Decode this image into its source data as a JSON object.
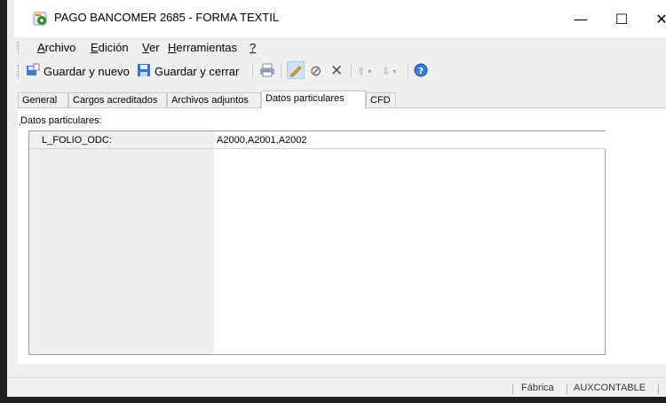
{
  "window": {
    "title": "PAGO BANCOMER 2685 - FORMA TEXTIL",
    "minimize": "—",
    "maximize": "☐",
    "close": "✕"
  },
  "menu": [
    {
      "label": "Archivo",
      "accel": "A",
      "rest": "rchivo"
    },
    {
      "label": "Edición",
      "accel": "E",
      "rest": "dición"
    },
    {
      "label": "Ver",
      "accel": "V",
      "rest": "er"
    },
    {
      "label": "Herramientas",
      "accel": "H",
      "rest": "erramientas"
    },
    {
      "label": "?",
      "accel": "?",
      "rest": ""
    }
  ],
  "toolbar": {
    "save_new_label": "Guardar y nuevo",
    "save_close_label": "Guardar y cerrar"
  },
  "tabs": [
    {
      "label": "General"
    },
    {
      "label": "Cargos acreditados"
    },
    {
      "label": "Archivos adjuntos"
    },
    {
      "label": "Datos particulares"
    },
    {
      "label": "CFD"
    }
  ],
  "section": {
    "label": "Datos particulares:"
  },
  "grid": {
    "rows": [
      {
        "name": "L_FOLIO_ODC:",
        "value": "A2000,A2001,A2002"
      }
    ]
  },
  "status": {
    "item1": "Fábrica",
    "item2": "AUXCONTABLE"
  },
  "colors": {
    "accent": "#2f8f2f",
    "title_bg": "#ffffff",
    "chrome_bg": "#f0f0f0"
  }
}
